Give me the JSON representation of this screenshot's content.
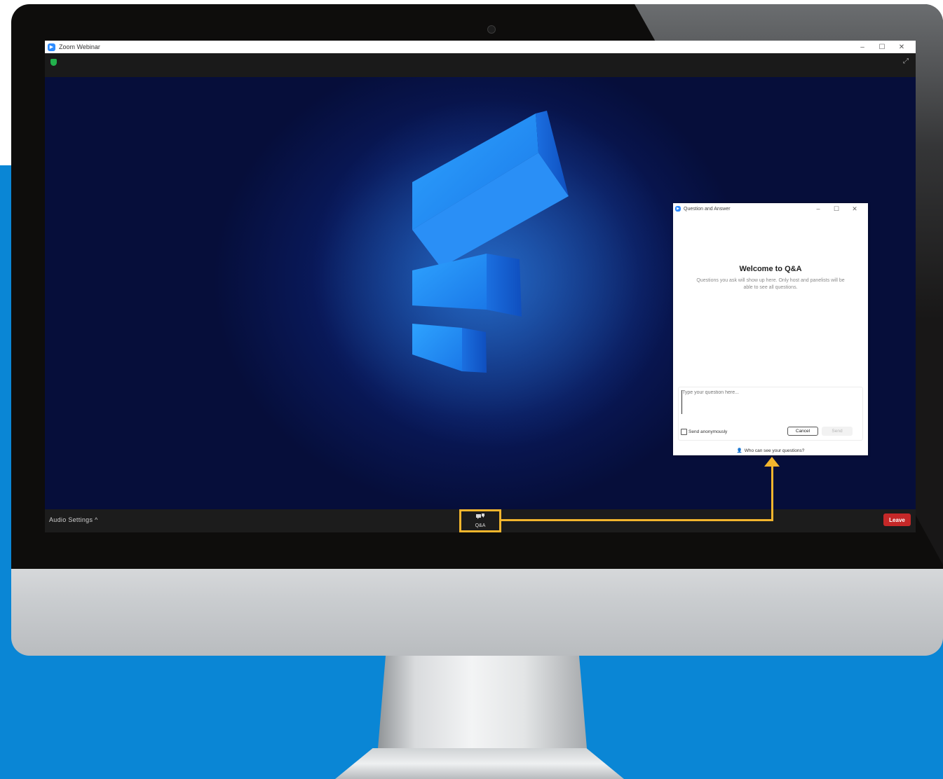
{
  "colors": {
    "accent_callout": "#f2b52d",
    "leave_button": "#c52828",
    "background_blue": "#0a86d5",
    "zoom_blue": "#2d8cff"
  },
  "zoom_window": {
    "title": "Zoom Webinar",
    "controls": [
      "–",
      "☐",
      "✕"
    ]
  },
  "bottom_bar": {
    "audio_settings": "Audio Settings",
    "audio_chevron": "^",
    "qa_icon": "chat-bubbles-icon",
    "qa_label": "Q&A",
    "leave_label": "Leave"
  },
  "qa_window": {
    "title": "Question and Answer",
    "controls": [
      "–",
      "☐",
      "✕"
    ],
    "welcome_title": "Welcome to Q&A",
    "welcome_text": "Questions you ask will show up here. Only host and panelists will be able to see all questions.",
    "input_placeholder": "Type your question here...",
    "anonymous_label": "Send anonymously",
    "anonymous_checked": false,
    "cancel_label": "Cancel",
    "send_label": "Send",
    "who_can_see": "Who can see your questions?"
  }
}
